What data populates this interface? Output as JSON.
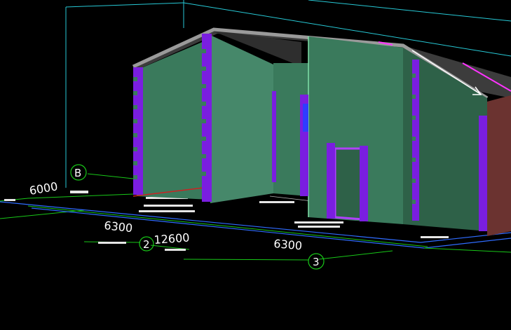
{
  "viewport": {
    "background": "#000000"
  },
  "colors": {
    "wall_green": "#3a7a5c",
    "wall_green_dark": "#2e6148",
    "wall_green_light": "#46886a",
    "roof_dark": "#3c3c3c",
    "roof_edge": "#9a9a9a",
    "column_purple": "#7a1ee0",
    "door_outline": "#b040ff",
    "brick_red": "#6b3330",
    "grid_cyan": "#27c9d6",
    "axis_green": "#18c818",
    "dim_blue": "#2f6cff",
    "magenta_line": "#ff33ff"
  },
  "dimensions": {
    "d_6000": "6000",
    "d_6300_left": "6300",
    "d_12600": "12600",
    "d_6300_right": "6300"
  },
  "axes": {
    "axis_b": "B",
    "axis_2": "2",
    "axis_3": "3"
  },
  "icons": {
    "roof_arrow": "arrow-icon"
  }
}
